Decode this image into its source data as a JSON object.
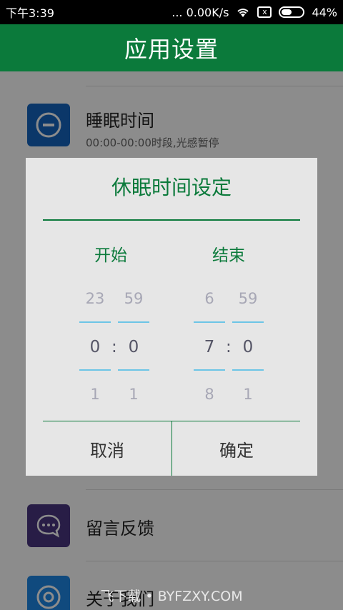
{
  "status": {
    "time": "下午3:39",
    "speed": "... 0.00K/s",
    "sim": "x",
    "battery": "44%"
  },
  "header": {
    "title": "应用设置"
  },
  "list": [
    {
      "title": "睡眠时间",
      "subtitle": "00:00-00:00时段,光感暂停"
    },
    {
      "title": "留言反馈"
    },
    {
      "title": "关于我们"
    }
  ],
  "dialog": {
    "title": "休眠时间设定",
    "start_label": "开始",
    "end_label": "结束",
    "start": {
      "hour_prev": "23",
      "hour": "0",
      "hour_next": "1",
      "min_prev": "59",
      "min": "0",
      "min_next": "1"
    },
    "end": {
      "hour_prev": "6",
      "hour": "7",
      "hour_next": "8",
      "min_prev": "59",
      "min": "0",
      "min_next": "1"
    },
    "separator": ":",
    "cancel": "取消",
    "confirm": "确定"
  },
  "watermark": "飞下载 • BYFZXY.COM",
  "colors": {
    "brand": "#0b7a3b",
    "picker_line": "#6cc5e6"
  }
}
